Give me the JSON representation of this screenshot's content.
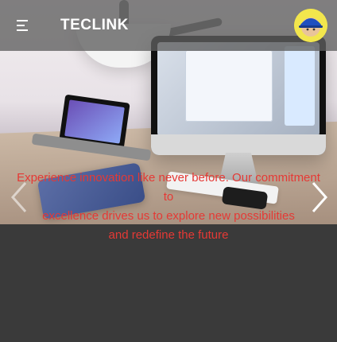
{
  "header": {
    "brand": "TECLINK",
    "menu_icon": "hamburger-menu-icon",
    "avatar_icon": "hard-hat-avatar-icon"
  },
  "hero": {
    "caption_lines": [
      "Experience innovation like never before. Our commitment",
      "to",
      "excellence drives us to explore new possibilities",
      "and redefine the future"
    ],
    "prev_icon": "chevron-left-icon",
    "next_icon": "chevron-right-icon"
  },
  "colors": {
    "topbar": "#5f5f5f",
    "caption": "#e53935",
    "page_background": "#3a3a3a",
    "avatar_background": "#f2e64d"
  }
}
